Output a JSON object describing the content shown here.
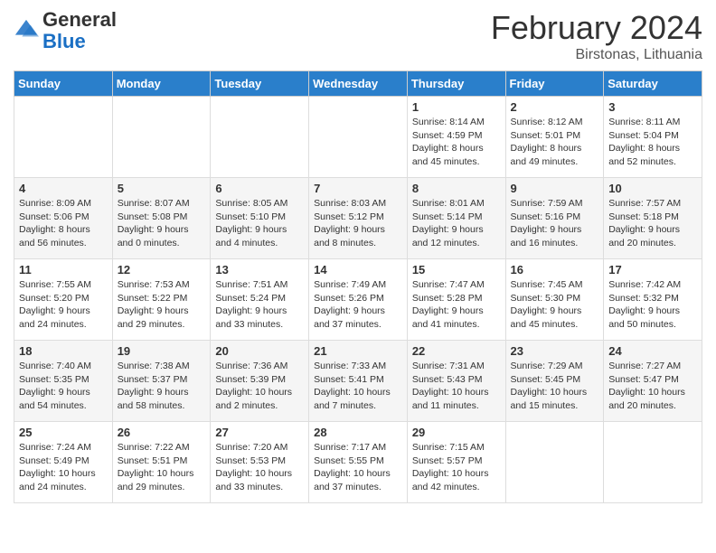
{
  "header": {
    "logo_general": "General",
    "logo_blue": "Blue",
    "month_title": "February 2024",
    "location": "Birstonas, Lithuania"
  },
  "weekdays": [
    "Sunday",
    "Monday",
    "Tuesday",
    "Wednesday",
    "Thursday",
    "Friday",
    "Saturday"
  ],
  "weeks": [
    [
      {
        "day": "",
        "info": ""
      },
      {
        "day": "",
        "info": ""
      },
      {
        "day": "",
        "info": ""
      },
      {
        "day": "",
        "info": ""
      },
      {
        "day": "1",
        "info": "Sunrise: 8:14 AM\nSunset: 4:59 PM\nDaylight: 8 hours\nand 45 minutes."
      },
      {
        "day": "2",
        "info": "Sunrise: 8:12 AM\nSunset: 5:01 PM\nDaylight: 8 hours\nand 49 minutes."
      },
      {
        "day": "3",
        "info": "Sunrise: 8:11 AM\nSunset: 5:04 PM\nDaylight: 8 hours\nand 52 minutes."
      }
    ],
    [
      {
        "day": "4",
        "info": "Sunrise: 8:09 AM\nSunset: 5:06 PM\nDaylight: 8 hours\nand 56 minutes."
      },
      {
        "day": "5",
        "info": "Sunrise: 8:07 AM\nSunset: 5:08 PM\nDaylight: 9 hours\nand 0 minutes."
      },
      {
        "day": "6",
        "info": "Sunrise: 8:05 AM\nSunset: 5:10 PM\nDaylight: 9 hours\nand 4 minutes."
      },
      {
        "day": "7",
        "info": "Sunrise: 8:03 AM\nSunset: 5:12 PM\nDaylight: 9 hours\nand 8 minutes."
      },
      {
        "day": "8",
        "info": "Sunrise: 8:01 AM\nSunset: 5:14 PM\nDaylight: 9 hours\nand 12 minutes."
      },
      {
        "day": "9",
        "info": "Sunrise: 7:59 AM\nSunset: 5:16 PM\nDaylight: 9 hours\nand 16 minutes."
      },
      {
        "day": "10",
        "info": "Sunrise: 7:57 AM\nSunset: 5:18 PM\nDaylight: 9 hours\nand 20 minutes."
      }
    ],
    [
      {
        "day": "11",
        "info": "Sunrise: 7:55 AM\nSunset: 5:20 PM\nDaylight: 9 hours\nand 24 minutes."
      },
      {
        "day": "12",
        "info": "Sunrise: 7:53 AM\nSunset: 5:22 PM\nDaylight: 9 hours\nand 29 minutes."
      },
      {
        "day": "13",
        "info": "Sunrise: 7:51 AM\nSunset: 5:24 PM\nDaylight: 9 hours\nand 33 minutes."
      },
      {
        "day": "14",
        "info": "Sunrise: 7:49 AM\nSunset: 5:26 PM\nDaylight: 9 hours\nand 37 minutes."
      },
      {
        "day": "15",
        "info": "Sunrise: 7:47 AM\nSunset: 5:28 PM\nDaylight: 9 hours\nand 41 minutes."
      },
      {
        "day": "16",
        "info": "Sunrise: 7:45 AM\nSunset: 5:30 PM\nDaylight: 9 hours\nand 45 minutes."
      },
      {
        "day": "17",
        "info": "Sunrise: 7:42 AM\nSunset: 5:32 PM\nDaylight: 9 hours\nand 50 minutes."
      }
    ],
    [
      {
        "day": "18",
        "info": "Sunrise: 7:40 AM\nSunset: 5:35 PM\nDaylight: 9 hours\nand 54 minutes."
      },
      {
        "day": "19",
        "info": "Sunrise: 7:38 AM\nSunset: 5:37 PM\nDaylight: 9 hours\nand 58 minutes."
      },
      {
        "day": "20",
        "info": "Sunrise: 7:36 AM\nSunset: 5:39 PM\nDaylight: 10 hours\nand 2 minutes."
      },
      {
        "day": "21",
        "info": "Sunrise: 7:33 AM\nSunset: 5:41 PM\nDaylight: 10 hours\nand 7 minutes."
      },
      {
        "day": "22",
        "info": "Sunrise: 7:31 AM\nSunset: 5:43 PM\nDaylight: 10 hours\nand 11 minutes."
      },
      {
        "day": "23",
        "info": "Sunrise: 7:29 AM\nSunset: 5:45 PM\nDaylight: 10 hours\nand 15 minutes."
      },
      {
        "day": "24",
        "info": "Sunrise: 7:27 AM\nSunset: 5:47 PM\nDaylight: 10 hours\nand 20 minutes."
      }
    ],
    [
      {
        "day": "25",
        "info": "Sunrise: 7:24 AM\nSunset: 5:49 PM\nDaylight: 10 hours\nand 24 minutes."
      },
      {
        "day": "26",
        "info": "Sunrise: 7:22 AM\nSunset: 5:51 PM\nDaylight: 10 hours\nand 29 minutes."
      },
      {
        "day": "27",
        "info": "Sunrise: 7:20 AM\nSunset: 5:53 PM\nDaylight: 10 hours\nand 33 minutes."
      },
      {
        "day": "28",
        "info": "Sunrise: 7:17 AM\nSunset: 5:55 PM\nDaylight: 10 hours\nand 37 minutes."
      },
      {
        "day": "29",
        "info": "Sunrise: 7:15 AM\nSunset: 5:57 PM\nDaylight: 10 hours\nand 42 minutes."
      },
      {
        "day": "",
        "info": ""
      },
      {
        "day": "",
        "info": ""
      }
    ]
  ]
}
